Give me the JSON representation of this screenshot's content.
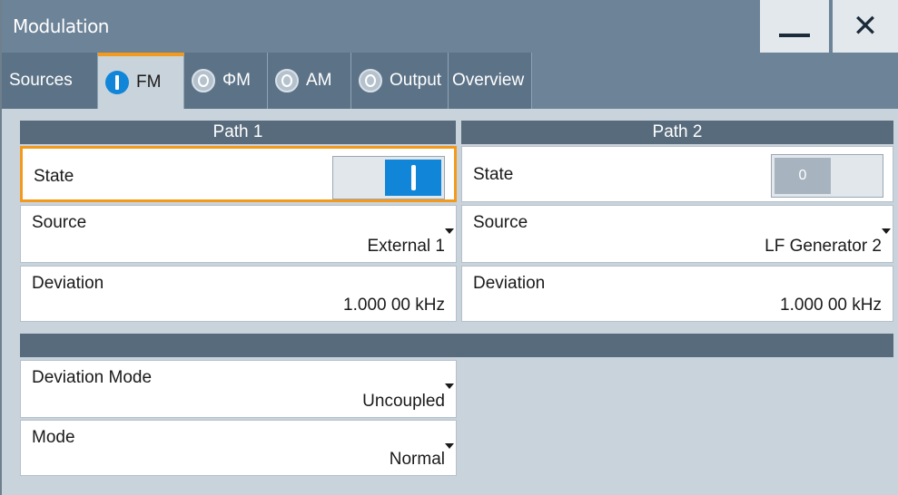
{
  "window": {
    "title": "Modulation"
  },
  "titlebar": {
    "minimize_icon": "minimize-icon",
    "close_icon": "close-icon",
    "close_glyph": "✕"
  },
  "tabs": [
    {
      "label": "Sources",
      "indicator": "none"
    },
    {
      "label": "FM",
      "indicator": "on"
    },
    {
      "label": "ΦM",
      "indicator": "off"
    },
    {
      "label": "AM",
      "indicator": "off"
    },
    {
      "label": "Output",
      "indicator": "off"
    },
    {
      "label": "Overview",
      "indicator": "none"
    }
  ],
  "path1": {
    "header": "Path 1",
    "state_label": "State",
    "state_value": "on",
    "source_label": "Source",
    "source_value": "External 1",
    "deviation_label": "Deviation",
    "deviation_value": "1.000 00 kHz"
  },
  "path2": {
    "header": "Path 2",
    "state_label": "State",
    "state_value": "0",
    "source_label": "Source",
    "source_value": "LF Generator 2",
    "deviation_label": "Deviation",
    "deviation_value": "1.000 00 kHz"
  },
  "common": {
    "header": "",
    "deviation_mode_label": "Deviation Mode",
    "deviation_mode_value": "Uncoupled",
    "mode_label": "Mode",
    "mode_value": "Normal"
  },
  "colors": {
    "accent": "#f39a1c",
    "active_blue": "#1186d9",
    "header_bg": "#586b7c",
    "titlebar_bg": "#6c8398"
  }
}
